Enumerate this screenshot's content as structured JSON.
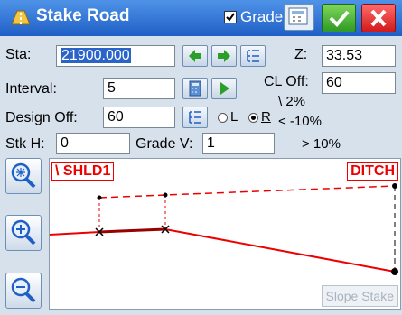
{
  "titlebar": {
    "title": "Stake Road",
    "grade_label": "Grade",
    "grade_checked": true
  },
  "form": {
    "sta_label": "Sta:",
    "sta_value": "21900.000",
    "interval_label": "Interval:",
    "interval_value": "5",
    "design_off_label": "Design Off:",
    "design_off_value": "60",
    "stk_h_label": "Stk H:",
    "stk_h_value": "0",
    "grade_v_label": "Grade V:",
    "grade_v_value": "1",
    "z_label": "Z:",
    "z_value": "33.53",
    "cl_off_label": "CL Off:",
    "cl_off_value": "60",
    "side_left": "L",
    "side_right": "R",
    "selected_side": "R",
    "grade_opt1": "\\ 2%",
    "grade_opt2": "< -10%",
    "grade_opt3": "> 10%"
  },
  "drawing": {
    "left_tag": "\\ SHLD1",
    "right_tag": "DITCH",
    "slope_stake_label": "Slope Stake"
  },
  "colors": {
    "accent": "#e00000",
    "title_bar": "#2e6fd6"
  },
  "icons": [
    "road-icon",
    "grade-checkbox-icon",
    "calculator-icon",
    "check-icon",
    "close-icon",
    "arrow-left-icon",
    "arrow-right-icon",
    "list-icon",
    "calculator-icon",
    "play-icon",
    "list-icon",
    "zoom-extents-icon",
    "zoom-in-icon",
    "zoom-out-icon"
  ]
}
